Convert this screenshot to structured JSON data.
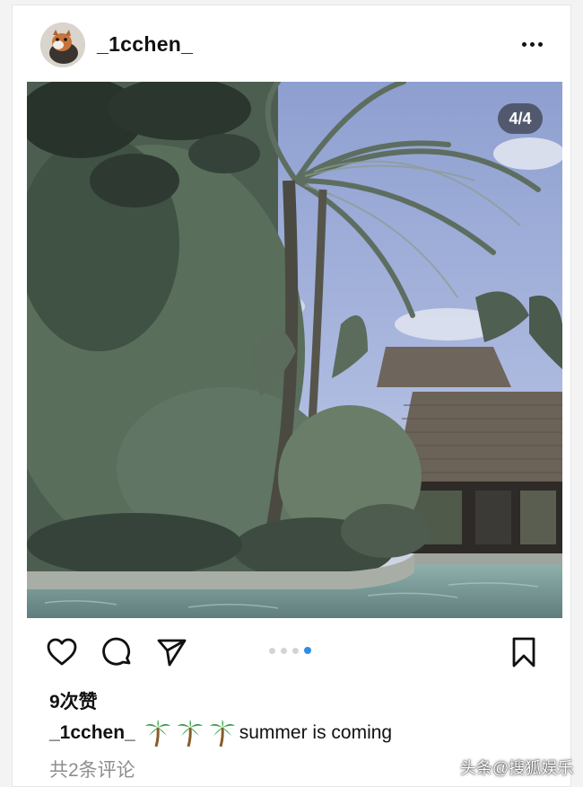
{
  "post": {
    "username": "_1cchen_",
    "image_counter": "4/4",
    "carousel_total": 4,
    "carousel_active_index": 4,
    "likes": "9次赞",
    "caption_username": "_1cchen_",
    "caption_text": "summer is coming",
    "caption_emoji": "palm-tree-icon ×3",
    "comments": "共2条评论"
  },
  "icons": {
    "more": "more-horizontal-icon",
    "like": "heart-icon",
    "comment": "comment-bubble-icon",
    "share": "send-icon",
    "save": "bookmark-icon"
  },
  "colors": {
    "accent_dot": "#2f8fe6",
    "inactive_dot": "#d4d4d4",
    "comments_text": "#8e8e8e"
  },
  "watermark": "头条@搜狐娱乐"
}
